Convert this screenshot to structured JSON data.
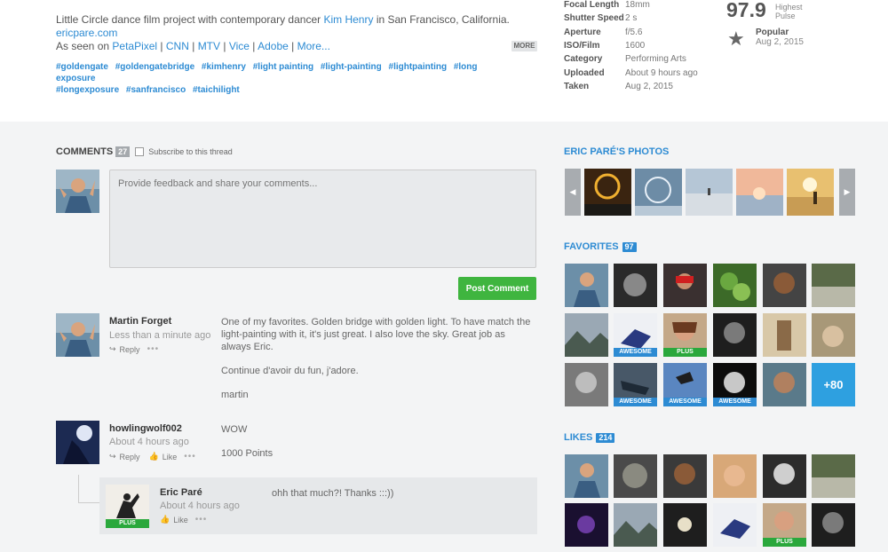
{
  "description": {
    "text1": "Little Circle dance film project with contemporary dancer",
    "dancer_link": "Kim Henry",
    "text2": "in San Francisco, California.",
    "site_link": "ericpare.com",
    "seen_prefix": "As seen on",
    "press": [
      "PetaPixel",
      "CNN",
      "MTV",
      "Vice",
      "Adobe",
      "More..."
    ],
    "more_label": "MORE"
  },
  "tags": [
    "#goldengate",
    "#goldengatebridge",
    "#kimhenry",
    "#light painting",
    "#light-painting",
    "#lightpainting",
    "#long exposure",
    "#longexposure",
    "#sanfrancisco",
    "#taichilight"
  ],
  "meta": [
    {
      "k": "Focal Length",
      "v": "18mm"
    },
    {
      "k": "Shutter Speed",
      "v": "2 s"
    },
    {
      "k": "Aperture",
      "v": "f/5.6"
    },
    {
      "k": "ISO/Film",
      "v": "1600"
    },
    {
      "k": "Category",
      "v": "Performing Arts"
    },
    {
      "k": "Uploaded",
      "v": "About 9 hours ago"
    },
    {
      "k": "Taken",
      "v": "Aug 2, 2015"
    }
  ],
  "pulse": {
    "value": "97.9",
    "line1": "Highest",
    "line2": "Pulse"
  },
  "popular": {
    "label": "Popular",
    "date": "Aug 2, 2015"
  },
  "comments": {
    "title": "COMMENTS",
    "count": "27",
    "subscribe": "Subscribe to this thread",
    "placeholder": "Provide feedback and share your comments...",
    "post_label": "Post Comment",
    "reply_label": "Reply",
    "like_label": "Like",
    "items": [
      {
        "name": "Martin Forget",
        "time": "Less than a minute ago",
        "p1": "One of my favorites. Golden bridge with golden light. To have match the light-painting with it, it's just great. I also love the sky. Great job as always Eric.",
        "p2": "Continue d'avoir du fun, j'adore.",
        "p3": "martin"
      },
      {
        "name": "howlingwolf002",
        "time": "About 4 hours ago",
        "p1": "WOW",
        "p2": "1000 Points"
      },
      {
        "name": "Eric Paré",
        "time": "About 4 hours ago",
        "p1": "ohh that much?! Thanks :::))",
        "badge": "PLUS"
      }
    ]
  },
  "sidebar": {
    "photos_title": "ERIC PARÉ'S PHOTOS",
    "favorites_title": "FAVORITES",
    "favorites_count": "97",
    "likes_title": "LIKES",
    "likes_count": "214",
    "plus_badge": "PLUS",
    "awesome_badge": "AWESOME",
    "more_count": "+80"
  },
  "colors": {
    "accent": "#2d8bd3",
    "post_button": "#3fb53f",
    "plus_badge": "#2aa83c"
  }
}
